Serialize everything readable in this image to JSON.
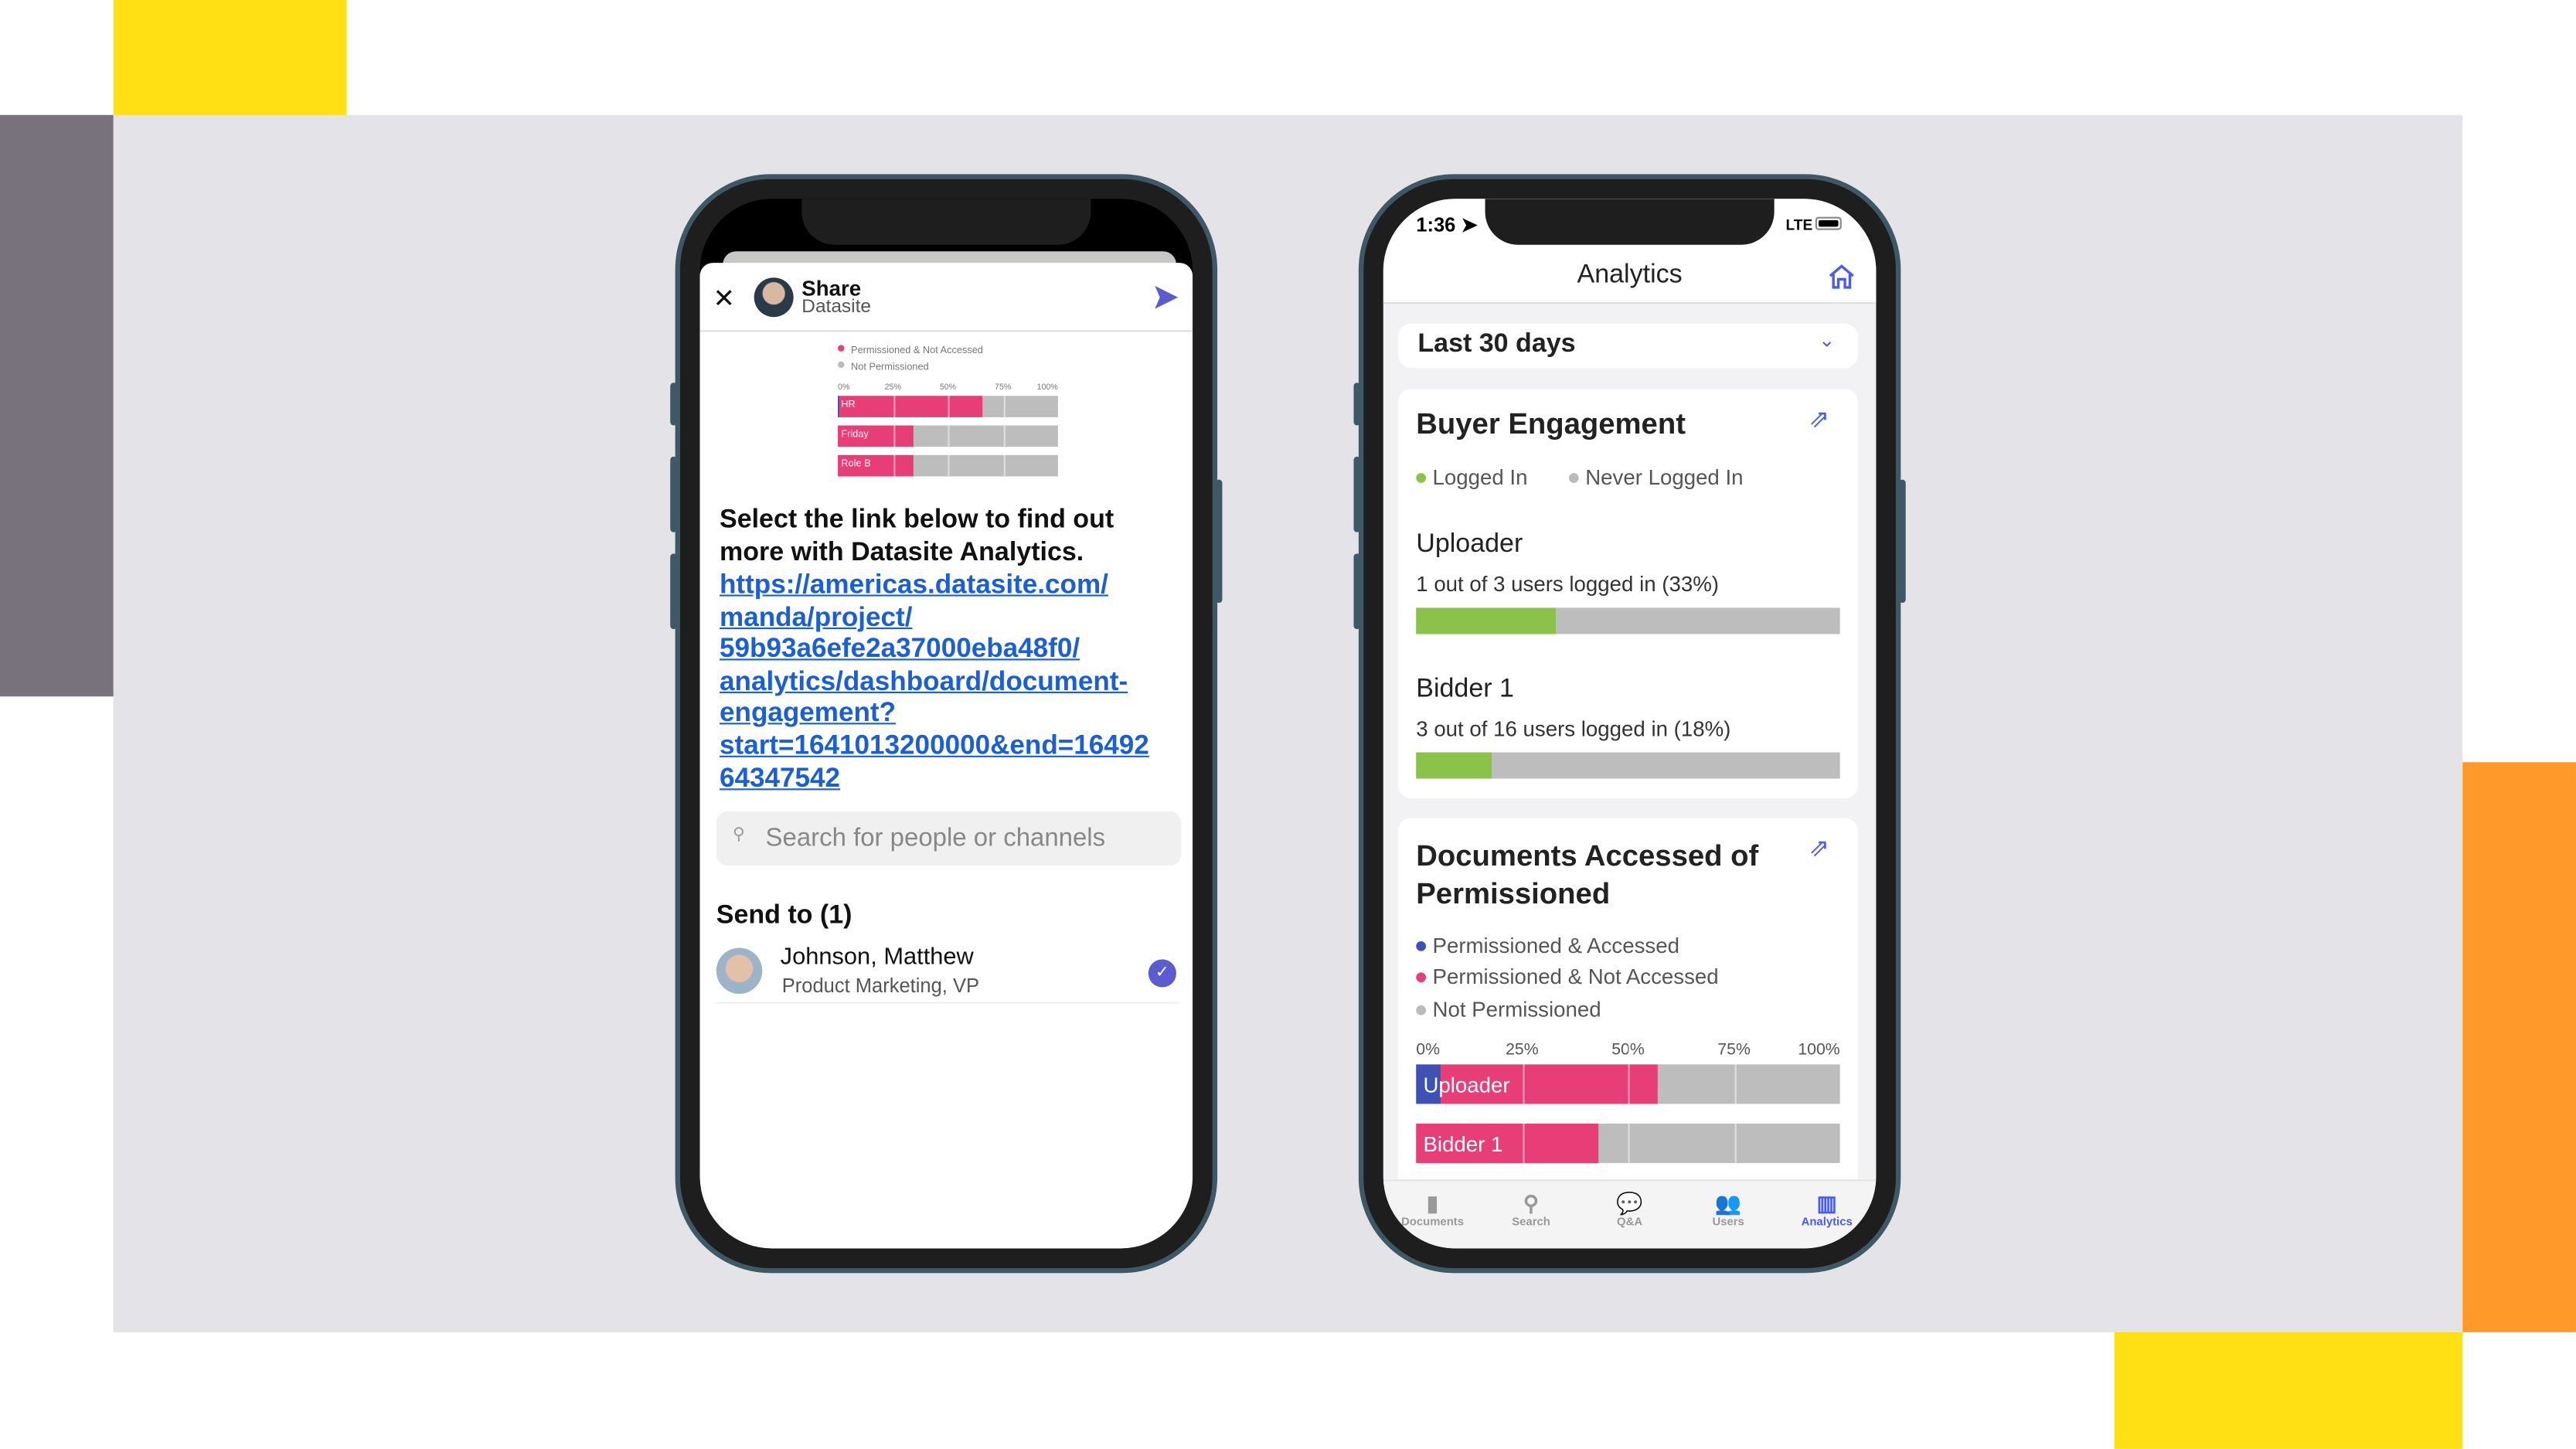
{
  "colors": {
    "yellow": "#FFE014",
    "orange": "#FF9A2A",
    "slate": "#77727c",
    "panel": "#e4e4e8",
    "accent": "#4a5cf0",
    "pink": "#e83e77",
    "green": "#8bc34a",
    "gray_bar": "#bdbdbd",
    "blue_seg": "#3f51b5"
  },
  "left_phone": {
    "header": {
      "title": "Share",
      "subtitle": "Datasite",
      "close_icon": "close-icon",
      "send_icon": "send-icon"
    },
    "preview_chart": {
      "legend": [
        "Permissioned & Not Accessed",
        "Not Permissioned"
      ],
      "ticks": [
        "0%",
        "25%",
        "50%",
        "75%",
        "100%"
      ],
      "rows": [
        {
          "label": "HR",
          "accessed": 1,
          "not_accessed": 65
        },
        {
          "label": "Friday",
          "accessed": 0,
          "not_accessed": 34
        },
        {
          "label": "Role B",
          "accessed": 0,
          "not_accessed": 34
        }
      ]
    },
    "message": "Select the link below to find out more with Datasite Analytics.",
    "link": "https://americas.datasite.com/manda/project/59b93a6efe2a37000eba48f0/analytics/dashboard/document-engagement?start=1641013200000&end=1649264347542",
    "link_lines": [
      "https://americas.datasite.com/",
      "manda/project/",
      "59b93a6efe2a37000eba48f0/",
      "analytics/dashboard/document-",
      "engagement?",
      "start=1641013200000&end=16492",
      "64347542"
    ],
    "search_placeholder": "Search for people or channels",
    "send_to_label": "Send to (1)",
    "recipient": {
      "name": "Johnson, Matthew",
      "title": "Product Marketing, VP",
      "selected": true
    }
  },
  "right_phone": {
    "status": {
      "time": "1:36",
      "network": "LTE"
    },
    "title": "Analytics",
    "range": "Last 30 days",
    "engagement": {
      "title": "Buyer Engagement",
      "legend": [
        "Logged In",
        "Never Logged In"
      ],
      "groups": [
        {
          "name": "Uploader",
          "text": "1 out of 3 users logged in (33%)",
          "pct": 33
        },
        {
          "name": "Bidder 1",
          "text": "3 out of 16 users logged in (18%)",
          "pct": 18
        }
      ]
    },
    "documents": {
      "title": "Documents Accessed of Permissioned",
      "legend": [
        "Permissioned & Accessed",
        "Permissioned & Not Accessed",
        "Not Permissioned"
      ],
      "ticks": [
        "0%",
        "25%",
        "50%",
        "75%",
        "100%"
      ],
      "rows": [
        {
          "label": "Uploader",
          "accessed": 6,
          "not_accessed": 51
        },
        {
          "label": "Bidder 1",
          "accessed": 0,
          "not_accessed": 43
        }
      ]
    },
    "tabs": [
      {
        "label": "Documents"
      },
      {
        "label": "Search"
      },
      {
        "label": "Q&A"
      },
      {
        "label": "Users"
      },
      {
        "label": "Analytics",
        "active": true
      }
    ]
  }
}
